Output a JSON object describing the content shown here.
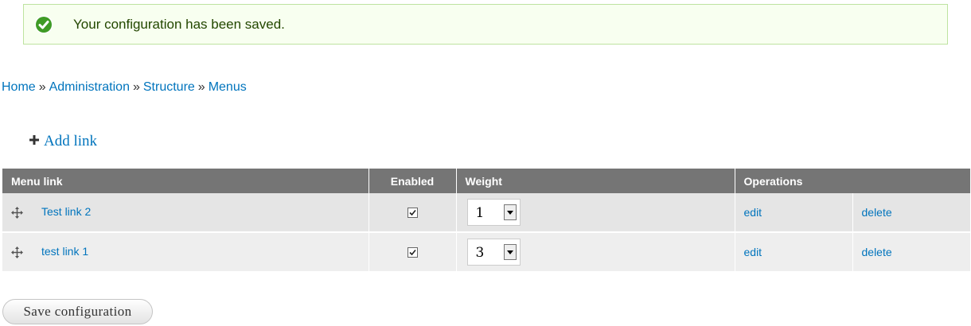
{
  "status": {
    "message": "Your configuration has been saved.",
    "color": "#77b91c"
  },
  "breadcrumb": {
    "items": [
      "Home",
      "Administration",
      "Structure",
      "Menus"
    ],
    "separator": "»"
  },
  "add_link": {
    "label": "Add link"
  },
  "table": {
    "headers": {
      "menu_link": "Menu link",
      "enabled": "Enabled",
      "weight": "Weight",
      "operations": "Operations"
    },
    "rows": [
      {
        "title": "Test link 2",
        "enabled": true,
        "weight": "1",
        "edit": "edit",
        "delete": "delete"
      },
      {
        "title": "test link 1",
        "enabled": true,
        "weight": "3",
        "edit": "edit",
        "delete": "delete"
      }
    ]
  },
  "actions": {
    "save": "Save configuration"
  },
  "colors": {
    "link": "#0074bd",
    "header_bg": "#757575"
  }
}
